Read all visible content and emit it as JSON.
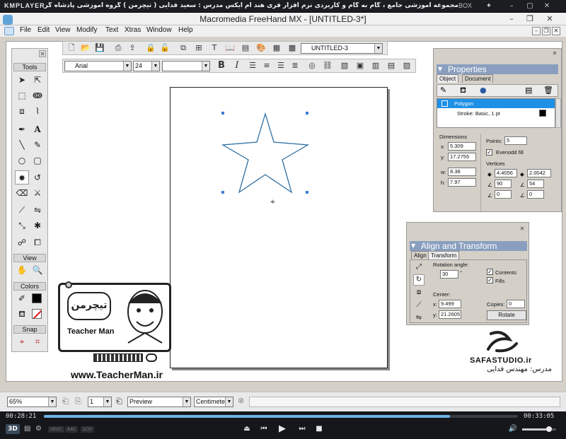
{
  "player": {
    "logo": "KMPLAYER",
    "title": "مجموعه آموزشی جامع ، گام به گام و کاربردی نرم افزار فری هند ام ایکس   مدرس : سعید فدایی ( تیچرمن ) گروه آموزشی پادشاه گرافیست ها",
    "box_label": "BOX",
    "elapsed": "00:28:21",
    "total": "00:33:05",
    "badges": [
      "3D",
      "HEVC",
      "AAC",
      "2CH"
    ]
  },
  "app": {
    "title": "Macromedia FreeHand MX - [UNTITLED-3*]"
  },
  "menu": [
    "File",
    "Edit",
    "View",
    "Modify",
    "Text",
    "Xtras",
    "Window",
    "Help"
  ],
  "toolbar": {
    "document_select": "UNTITLED-3",
    "font": "Arial",
    "font_size": "24",
    "font_style": ""
  },
  "tools": {
    "header": "Tools",
    "view_header": "View",
    "colors_header": "Colors",
    "snap_header": "Snap"
  },
  "properties": {
    "title": "Properties",
    "tabs": [
      "Object",
      "Document"
    ],
    "list": [
      "Polygon",
      "Stroke: Basic, 1 pt"
    ],
    "dimensions_label": "Dimensions",
    "x_label": "x:",
    "x": "5.309",
    "y_label": "y:",
    "y": "17.2755",
    "w_label": "w:",
    "w": "8.38",
    "h_label": "h:",
    "h": "7.97",
    "points_label": "Points:",
    "points": "5",
    "evenodd_label": "Evenodd fill",
    "vertices_label": "Vertices",
    "v1": "4.4056",
    "v2": "2.0042",
    "v3": "90",
    "v4": "54",
    "v5": "0",
    "v6": "0"
  },
  "align": {
    "title": "Align and Transform",
    "tabs": [
      "Align",
      "Transform"
    ],
    "rotation_label": "Rotation angle:",
    "rotation": "30",
    "degree": "°",
    "contents_label": "Contents",
    "fills_label": "Fills",
    "center_label": "Center:",
    "cx_label": "x:",
    "cx": "9.499",
    "cy_label": "y:",
    "cy": "21.2605",
    "copies_label": "Copies:",
    "copies": "0",
    "rotate_button": "Rotate"
  },
  "status": {
    "zoom": "65%",
    "page": "1",
    "view_mode": "Preview",
    "units": "Centimeters"
  },
  "branding": {
    "teacher_logo": "تیچرمن",
    "teacher_sub": "Teacher Man",
    "teacher_url": "www.TeacherMan.ir",
    "studio": "SAFASTUDIO.ir",
    "studio_credit": "مدرس: مهندس فدایی"
  },
  "colors": {
    "panel_title": "#8a9fbf",
    "selection": "#1e90e6",
    "star_stroke": "#2d6fa3",
    "handle": "#3b7fd1"
  }
}
